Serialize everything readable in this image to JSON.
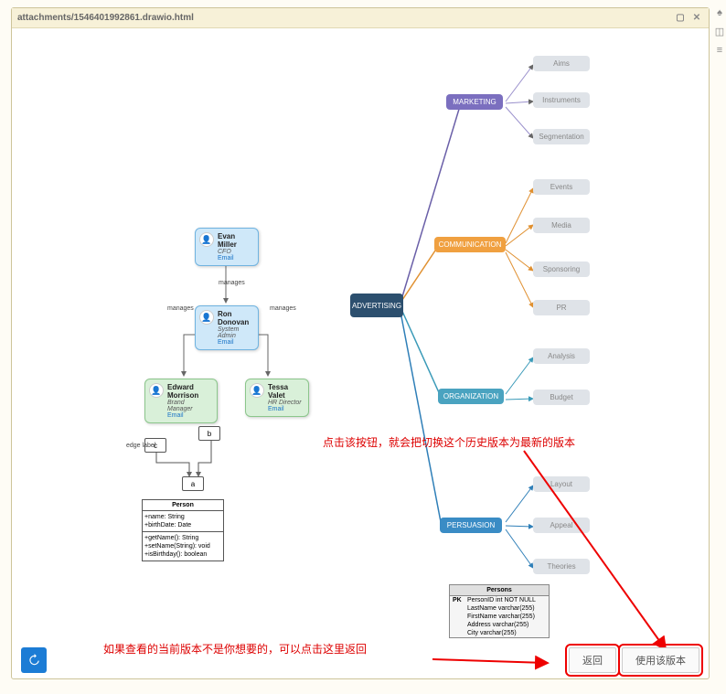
{
  "window": {
    "title": "attachments/1546401992861.drawio.html"
  },
  "org": {
    "manages_label": "manages",
    "ceo": {
      "name": "Evan Miller",
      "role": "CFO",
      "email": "Email"
    },
    "admin": {
      "name": "Ron Donovan",
      "role": "System Admin",
      "email": "Email"
    },
    "mgr1": {
      "name": "Edward Morrison",
      "role": "Brand Manager",
      "email": "Email"
    },
    "mgr2": {
      "name": "Tessa Valet",
      "role": "HR Director",
      "email": "Email"
    }
  },
  "abc": {
    "a": "a",
    "b": "b",
    "c": "c",
    "edge_label": "edge label"
  },
  "uml": {
    "title": "Person",
    "attrs": [
      "+name: String",
      "+birthDate: Date"
    ],
    "ops": [
      "+getName(): String",
      "+setName(String): void",
      "+isBirthday(): boolean"
    ]
  },
  "mindmap": {
    "root": "ADVERTISING",
    "marketing": {
      "label": "MARKETING",
      "children": [
        "Aims",
        "Instruments",
        "Segmentation"
      ]
    },
    "communication": {
      "label": "COMMUNICATION",
      "children": [
        "Events",
        "Media",
        "Sponsoring",
        "PR"
      ]
    },
    "organization": {
      "label": "ORGANIZATION",
      "children": [
        "Analysis",
        "Budget"
      ]
    },
    "persuasion": {
      "label": "PERSUASION",
      "children": [
        "Layout",
        "Appeal",
        "Theories"
      ]
    }
  },
  "db": {
    "title": "Persons",
    "rows": [
      {
        "pk": "PK",
        "col": "PersonID int NOT NULL"
      },
      {
        "pk": "",
        "col": "LastName varchar(255)"
      },
      {
        "pk": "",
        "col": "FirstName varchar(255)"
      },
      {
        "pk": "",
        "col": "Address varchar(255)"
      },
      {
        "pk": "",
        "col": "City varchar(255)"
      }
    ]
  },
  "annotations": {
    "top": "点击该按钮，就会把切换这个历史版本为最新的版本",
    "bottom": "如果查看的当前版本不是你想要的，可以点击这里返回"
  },
  "buttons": {
    "back": "返回",
    "use_version": "使用该版本"
  }
}
